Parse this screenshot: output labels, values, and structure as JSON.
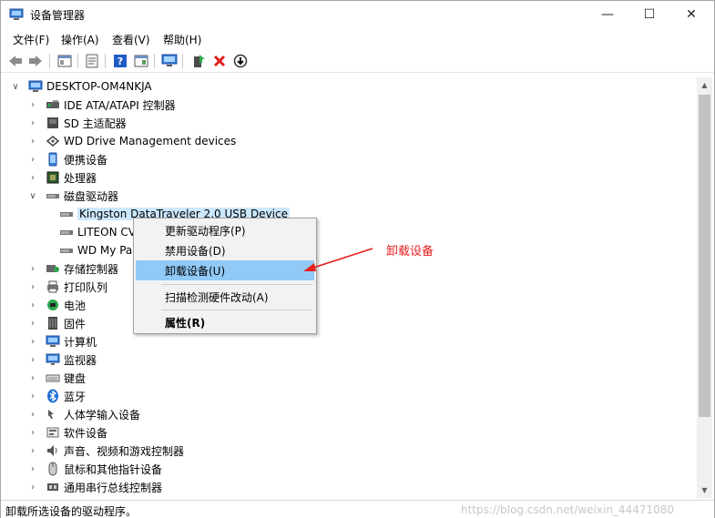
{
  "window": {
    "title": "设备管理器",
    "minimize_glyph": "—",
    "maximize_glyph": "☐",
    "close_glyph": "✕"
  },
  "menu": [
    "文件(F)",
    "操作(A)",
    "查看(V)",
    "帮助(H)"
  ],
  "toolbar": {
    "icons": [
      "back-icon",
      "forward-icon",
      "show-hide-tree-icon",
      "properties-icon",
      "help-icon",
      "action-pane-icon",
      "computer-monitor-icon",
      "update-driver-icon",
      "uninstall-icon",
      "download-icon"
    ]
  },
  "tree": {
    "root": "DESKTOP-OM4NKJA",
    "categories": [
      {
        "label": "IDE ATA/ATAPI 控制器",
        "expanded": false
      },
      {
        "label": "SD 主适配器",
        "expanded": false
      },
      {
        "label": "WD Drive Management devices",
        "expanded": false
      },
      {
        "label": "便携设备",
        "expanded": false
      },
      {
        "label": "处理器",
        "expanded": false
      },
      {
        "label": "磁盘驱动器",
        "expanded": true
      },
      {
        "label": "Kingston DataTraveler 2.0 USB Device",
        "child": true,
        "selected": true
      },
      {
        "label": "LITEON CV",
        "child": true
      },
      {
        "label": "WD My Pa",
        "child": true
      },
      {
        "label": "存储控制器",
        "expanded": false
      },
      {
        "label": "打印队列",
        "expanded": false
      },
      {
        "label": "电池",
        "expanded": false
      },
      {
        "label": "固件",
        "expanded": false
      },
      {
        "label": "计算机",
        "expanded": false
      },
      {
        "label": "监视器",
        "expanded": false
      },
      {
        "label": "键盘",
        "expanded": false
      },
      {
        "label": "蓝牙",
        "expanded": false
      },
      {
        "label": "人体学输入设备",
        "expanded": false
      },
      {
        "label": "软件设备",
        "expanded": false
      },
      {
        "label": "声音、视频和游戏控制器",
        "expanded": false
      },
      {
        "label": "鼠标和其他指针设备",
        "expanded": false
      },
      {
        "label": "通用串行总线控制器",
        "expanded": false
      }
    ]
  },
  "context_menu": {
    "items": [
      {
        "label": "更新驱动程序(P)"
      },
      {
        "label": "禁用设备(D)"
      },
      {
        "label": "卸载设备(U)",
        "highlighted": true
      },
      {
        "label": "扫描检测硬件改动(A)"
      },
      {
        "label": "属性(R)",
        "bold": true
      }
    ]
  },
  "annotation": {
    "text": "卸载设备",
    "color": "#e81e1e"
  },
  "status": {
    "text": "卸载所选设备的驱动程序。",
    "watermark": "https://blog.csdn.net/weixin_44471080"
  }
}
